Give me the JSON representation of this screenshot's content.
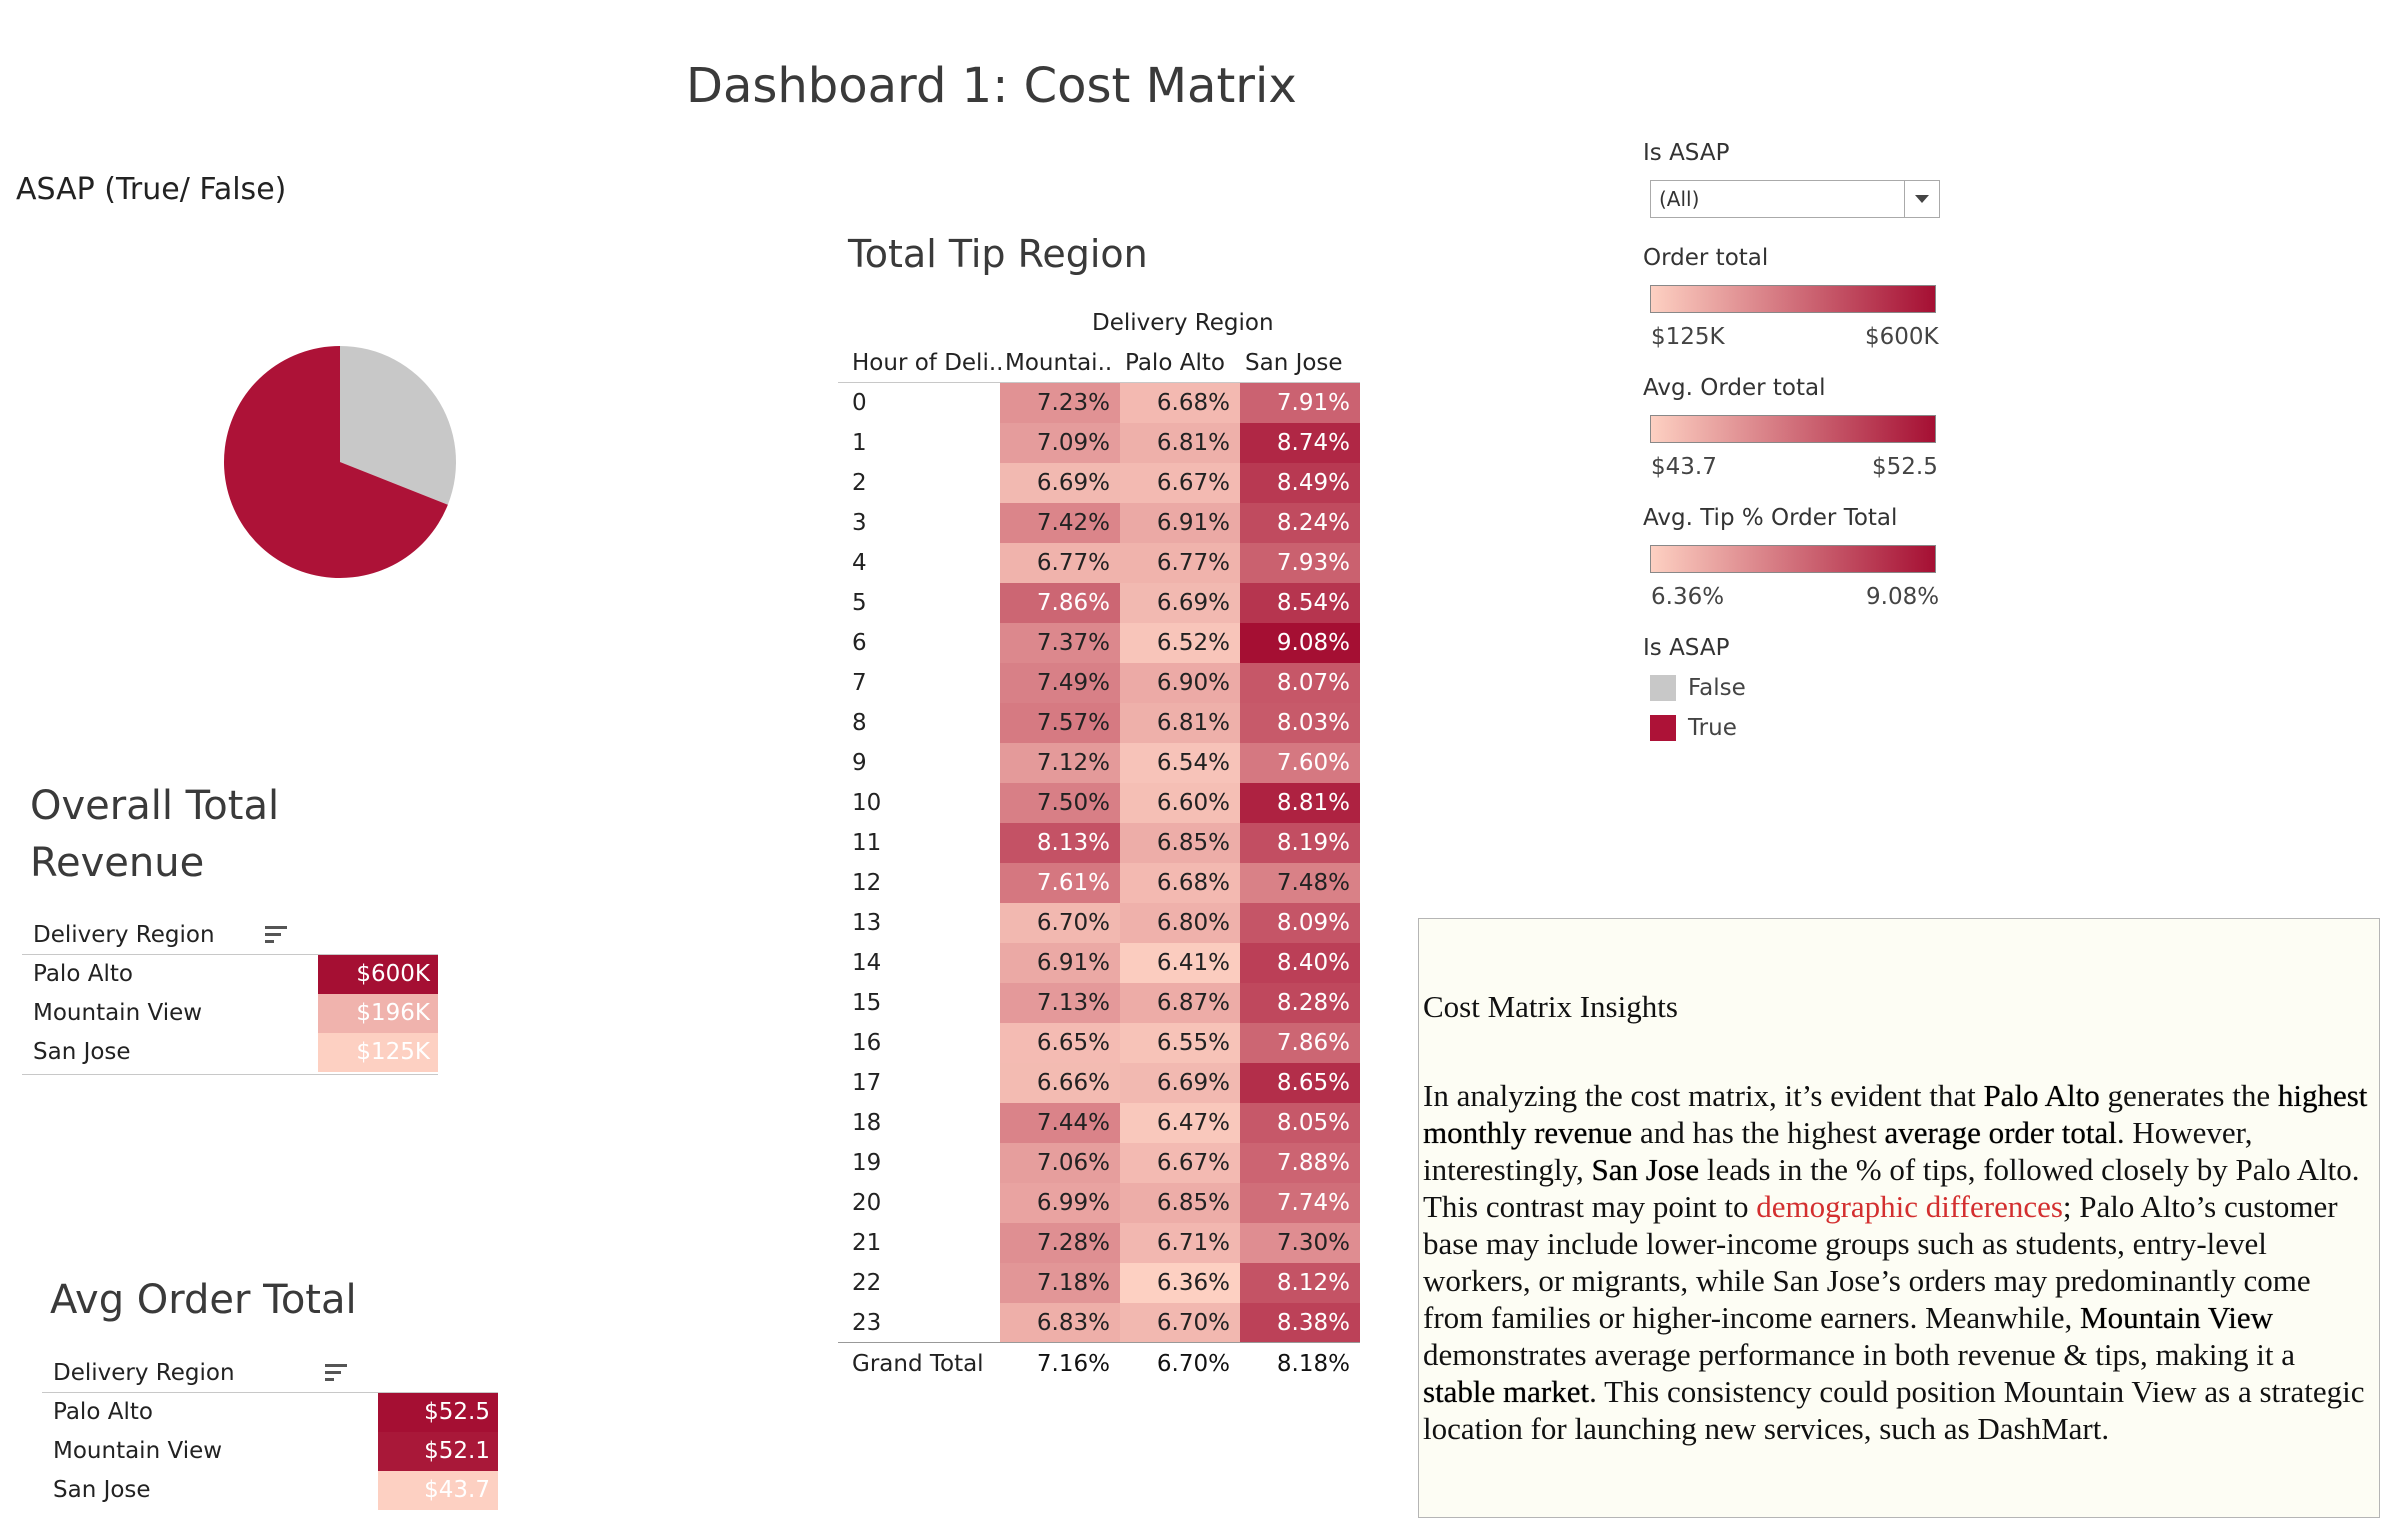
{
  "dashboard_title": "Dashboard 1: Cost Matrix",
  "pie": {
    "title": "ASAP (True/ False)",
    "slices": [
      {
        "label": "True",
        "share": 0.69,
        "color": "#ad1237"
      },
      {
        "label": "False",
        "share": 0.31,
        "color": "#c8c8c8"
      }
    ]
  },
  "tip_table": {
    "title": "Total Tip Region",
    "column_group": "Delivery Region",
    "row_header": "Hour of Deli..",
    "columns": [
      "Mountai..",
      "Palo Alto",
      "San Jose"
    ],
    "rows": [
      {
        "hour": "0",
        "values": [
          "7.23%",
          "6.68%",
          "7.91%"
        ],
        "nums": [
          7.23,
          6.68,
          7.91
        ]
      },
      {
        "hour": "1",
        "values": [
          "7.09%",
          "6.81%",
          "8.74%"
        ],
        "nums": [
          7.09,
          6.81,
          8.74
        ]
      },
      {
        "hour": "2",
        "values": [
          "6.69%",
          "6.67%",
          "8.49%"
        ],
        "nums": [
          6.69,
          6.67,
          8.49
        ]
      },
      {
        "hour": "3",
        "values": [
          "7.42%",
          "6.91%",
          "8.24%"
        ],
        "nums": [
          7.42,
          6.91,
          8.24
        ]
      },
      {
        "hour": "4",
        "values": [
          "6.77%",
          "6.77%",
          "7.93%"
        ],
        "nums": [
          6.77,
          6.77,
          7.93
        ]
      },
      {
        "hour": "5",
        "values": [
          "7.86%",
          "6.69%",
          "8.54%"
        ],
        "nums": [
          7.86,
          6.69,
          8.54
        ]
      },
      {
        "hour": "6",
        "values": [
          "7.37%",
          "6.52%",
          "9.08%"
        ],
        "nums": [
          7.37,
          6.52,
          9.08
        ]
      },
      {
        "hour": "7",
        "values": [
          "7.49%",
          "6.90%",
          "8.07%"
        ],
        "nums": [
          7.49,
          6.9,
          8.07
        ]
      },
      {
        "hour": "8",
        "values": [
          "7.57%",
          "6.81%",
          "8.03%"
        ],
        "nums": [
          7.57,
          6.81,
          8.03
        ]
      },
      {
        "hour": "9",
        "values": [
          "7.12%",
          "6.54%",
          "7.60%"
        ],
        "nums": [
          7.12,
          6.54,
          7.6
        ]
      },
      {
        "hour": "10",
        "values": [
          "7.50%",
          "6.60%",
          "8.81%"
        ],
        "nums": [
          7.5,
          6.6,
          8.81
        ]
      },
      {
        "hour": "11",
        "values": [
          "8.13%",
          "6.85%",
          "8.19%"
        ],
        "nums": [
          8.13,
          6.85,
          8.19
        ]
      },
      {
        "hour": "12",
        "values": [
          "7.61%",
          "6.68%",
          "7.48%"
        ],
        "nums": [
          7.61,
          6.68,
          7.48
        ]
      },
      {
        "hour": "13",
        "values": [
          "6.70%",
          "6.80%",
          "8.09%"
        ],
        "nums": [
          6.7,
          6.8,
          8.09
        ]
      },
      {
        "hour": "14",
        "values": [
          "6.91%",
          "6.41%",
          "8.40%"
        ],
        "nums": [
          6.91,
          6.41,
          8.4
        ]
      },
      {
        "hour": "15",
        "values": [
          "7.13%",
          "6.87%",
          "8.28%"
        ],
        "nums": [
          7.13,
          6.87,
          8.28
        ]
      },
      {
        "hour": "16",
        "values": [
          "6.65%",
          "6.55%",
          "7.86%"
        ],
        "nums": [
          6.65,
          6.55,
          7.86
        ]
      },
      {
        "hour": "17",
        "values": [
          "6.66%",
          "6.69%",
          "8.65%"
        ],
        "nums": [
          6.66,
          6.69,
          8.65
        ]
      },
      {
        "hour": "18",
        "values": [
          "7.44%",
          "6.47%",
          "8.05%"
        ],
        "nums": [
          7.44,
          6.47,
          8.05
        ]
      },
      {
        "hour": "19",
        "values": [
          "7.06%",
          "6.67%",
          "7.88%"
        ],
        "nums": [
          7.06,
          6.67,
          7.88
        ]
      },
      {
        "hour": "20",
        "values": [
          "6.99%",
          "6.85%",
          "7.74%"
        ],
        "nums": [
          6.99,
          6.85,
          7.74
        ]
      },
      {
        "hour": "21",
        "values": [
          "7.28%",
          "6.71%",
          "7.30%"
        ],
        "nums": [
          7.28,
          6.71,
          7.3
        ]
      },
      {
        "hour": "22",
        "values": [
          "7.18%",
          "6.36%",
          "8.12%"
        ],
        "nums": [
          7.18,
          6.36,
          8.12
        ]
      },
      {
        "hour": "23",
        "values": [
          "6.83%",
          "6.70%",
          "8.38%"
        ],
        "nums": [
          6.83,
          6.7,
          8.38
        ]
      }
    ],
    "grand_total_label": "Grand Total",
    "grand_total": [
      "7.16%",
      "6.70%",
      "8.18%"
    ]
  },
  "revenue": {
    "title_line1": "Overall Total",
    "title_line2": "Revenue",
    "header": "Delivery Region",
    "rows": [
      {
        "region": "Palo Alto",
        "value": "$600K",
        "num": 600
      },
      {
        "region": "Mountain View",
        "value": "$196K",
        "num": 196
      },
      {
        "region": "San Jose",
        "value": "$125K",
        "num": 125
      }
    ]
  },
  "avg_order": {
    "title": "Avg Order Total",
    "header": "Delivery Region",
    "rows": [
      {
        "region": "Palo Alto",
        "value": "$52.5",
        "num": 52.5
      },
      {
        "region": "Mountain View",
        "value": "$52.1",
        "num": 52.1
      },
      {
        "region": "San Jose",
        "value": "$43.7",
        "num": 43.7
      }
    ]
  },
  "filters": {
    "is_asap_label": "Is ASAP",
    "is_asap_value": "(All)"
  },
  "legends": {
    "order_total": {
      "label": "Order total",
      "min": "$125K",
      "max": "$600K"
    },
    "avg_order_total": {
      "label": "Avg. Order total",
      "min": "$43.7",
      "max": "$52.5"
    },
    "avg_tip": {
      "label": "Avg. Tip % Order Total",
      "min": "6.36%",
      "max": "9.08%"
    },
    "is_asap": {
      "label": "Is ASAP",
      "items": [
        {
          "label": "False",
          "color": "#c8c8c8"
        },
        {
          "label": "True",
          "color": "#ad1237"
        }
      ]
    }
  },
  "insights": {
    "title": "Cost Matrix Insights",
    "p1": "In analyzing the cost matrix, it’s evident that ",
    "b1": "Palo Alto",
    "p2": " generates the ",
    "b2": "highest monthly revenue",
    "p3": " and has the highest ",
    "b3": "average order total",
    "p4": ". However, interestingly, ",
    "b4": "San Jose",
    "p5": " leads in the % of tips, followed closely by Palo Alto. This contrast may point to ",
    "red1": "demographic differences",
    "p6": "; Palo Alto’s customer base may include lower-income groups such as students, entry-level workers, or migrants, while San Jose’s orders may predominantly come from families or higher-income earners. Meanwhile, ",
    "b5": "Mountain View",
    "p7": " demonstrates average performance in both revenue & tips, making it a ",
    "b6": "stable market",
    "p8": ". This consistency could position Mountain View as a strategic location for launching new services, such as DashMart."
  },
  "colors": {
    "scale_low": "#fdd0c2",
    "scale_high": "#a50f33"
  }
}
